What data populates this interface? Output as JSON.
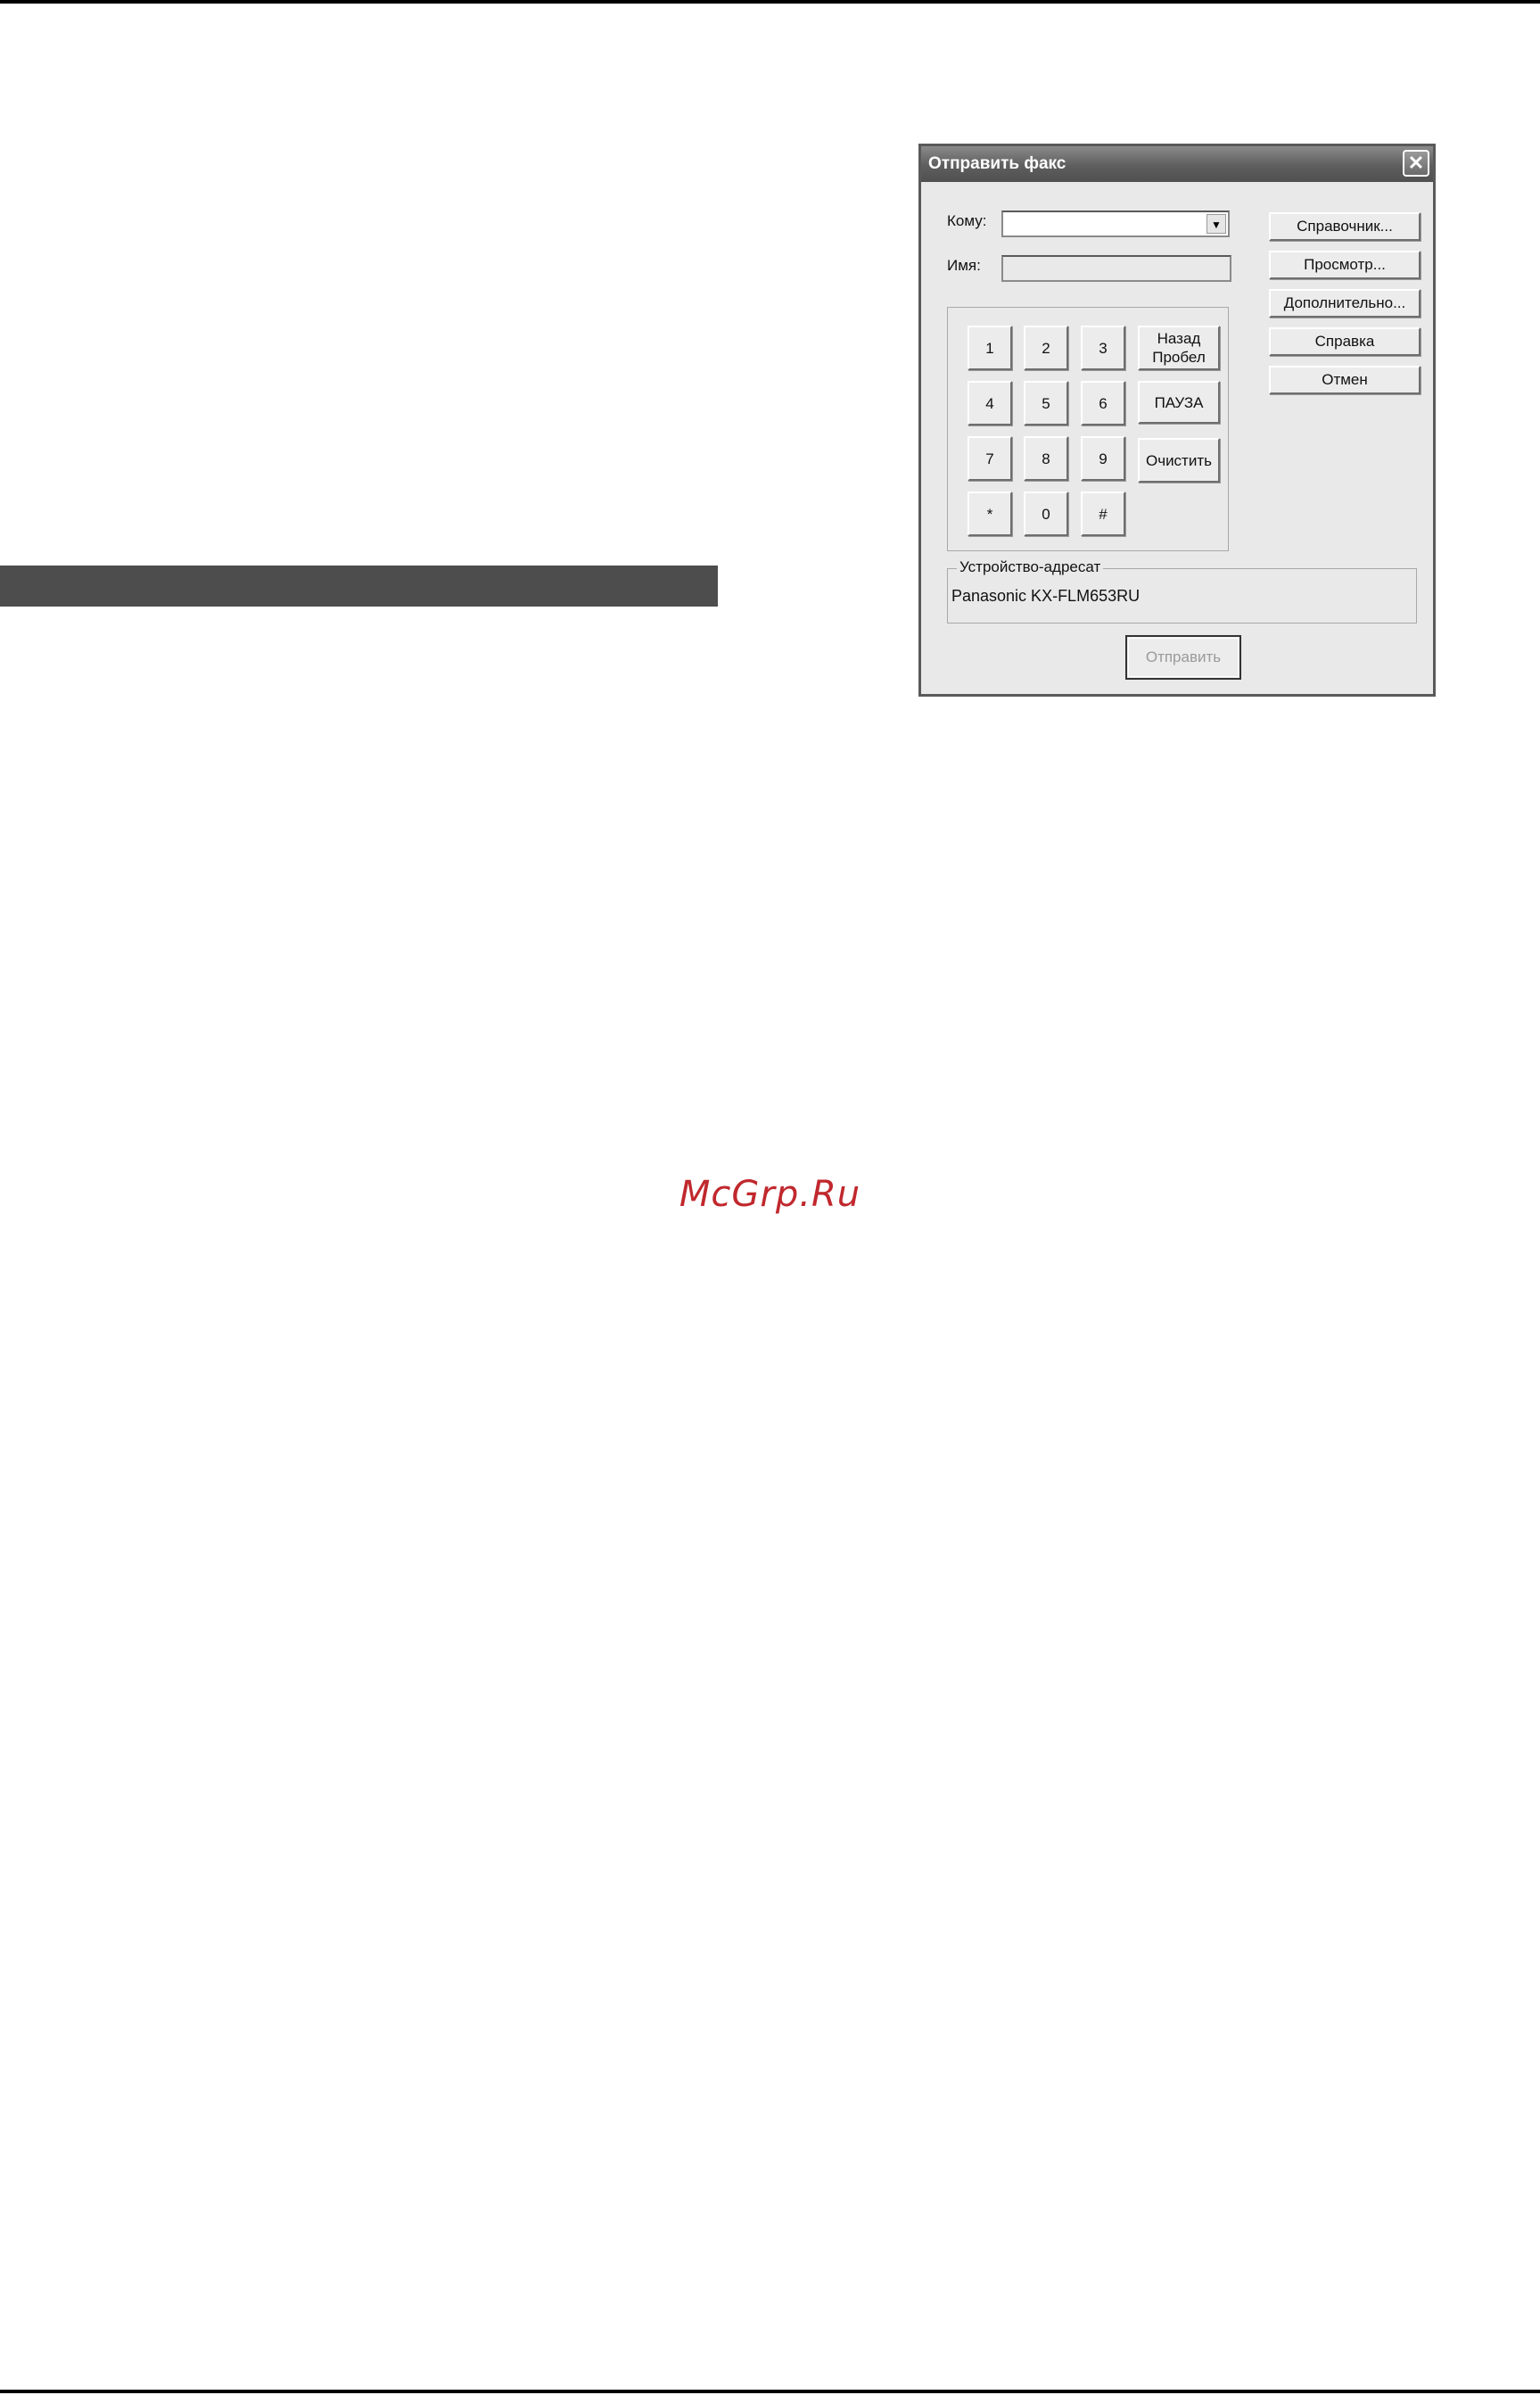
{
  "dialog": {
    "title": "Отправить факс",
    "close_label": "✕",
    "to_label": "Кому:",
    "to_value": "",
    "name_label": "Имя:",
    "name_value": "",
    "keypad": {
      "row1": [
        "1",
        "2",
        "3"
      ],
      "row2": [
        "4",
        "5",
        "6"
      ],
      "row3": [
        "7",
        "8",
        "9"
      ],
      "row4": [
        "*",
        "0",
        "#"
      ],
      "backspace_line1": "Назад",
      "backspace_line2": "Пробел",
      "pause": "ПАУЗА",
      "clear": "Очистить"
    },
    "buttons": {
      "phonebook": "Справочник...",
      "preview": "Просмотр...",
      "advanced": "Дополнительно...",
      "help": "Справка",
      "cancel": "Отмен",
      "send": "Отправить"
    },
    "destination": {
      "legend": "Устройство-адресат",
      "value": "Panasonic KX-FLM653RU"
    }
  },
  "watermark": "McGrp.Ru"
}
